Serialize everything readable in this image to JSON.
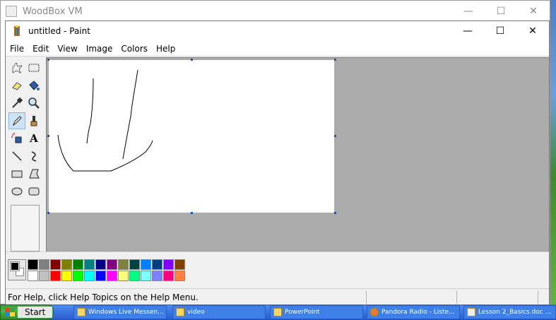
{
  "vm_window": {
    "title": "WoodBox VM",
    "min": "—",
    "max": "☐",
    "close": "✕"
  },
  "paint_window": {
    "title": "untitled - Paint",
    "min": "—",
    "max": "☐",
    "close": "✕"
  },
  "menu": [
    "File",
    "Edit",
    "View",
    "Image",
    "Colors",
    "Help"
  ],
  "tools": [
    {
      "name": "free-select-icon",
      "glyph": "☆"
    },
    {
      "name": "rect-select-icon",
      "glyph": "⬚"
    },
    {
      "name": "eraser-icon",
      "glyph": "▰"
    },
    {
      "name": "fill-bucket-icon",
      "glyph": "◆"
    },
    {
      "name": "color-picker-icon",
      "glyph": "✎"
    },
    {
      "name": "magnifier-icon",
      "glyph": "⚲"
    },
    {
      "name": "pencil-icon",
      "glyph": "✏"
    },
    {
      "name": "brush-icon",
      "glyph": "♜"
    },
    {
      "name": "airbrush-icon",
      "glyph": "✺"
    },
    {
      "name": "text-icon",
      "glyph": "A"
    },
    {
      "name": "line-icon",
      "glyph": "╲"
    },
    {
      "name": "curve-icon",
      "glyph": "∫"
    },
    {
      "name": "rectangle-icon",
      "glyph": "▭"
    },
    {
      "name": "polygon-icon",
      "glyph": "⏢"
    },
    {
      "name": "ellipse-icon",
      "glyph": "⬭"
    },
    {
      "name": "rounded-rect-icon",
      "glyph": "▢"
    }
  ],
  "selected_tool": "pencil-icon",
  "palette": {
    "row1": [
      "#000000",
      "#808080",
      "#800000",
      "#808000",
      "#008000",
      "#008080",
      "#000080",
      "#800080",
      "#808040",
      "#004040",
      "#0080ff",
      "#004080",
      "#8000ff",
      "#804000"
    ],
    "row2": [
      "#ffffff",
      "#c0c0c0",
      "#ff0000",
      "#ffff00",
      "#00ff00",
      "#00ffff",
      "#0000ff",
      "#ff00ff",
      "#ffff80",
      "#00ff80",
      "#80ffff",
      "#8080ff",
      "#ff0080",
      "#ff8040"
    ]
  },
  "status": {
    "text": "For Help, click Help Topics on the Help Menu."
  },
  "taskbar": {
    "start": "Start",
    "buttons": [
      "Windows Live Messen...",
      "video",
      "PowerPoint",
      "Pandora Radio - Liste...",
      "Lesson 2_Basics.doc ..."
    ]
  }
}
